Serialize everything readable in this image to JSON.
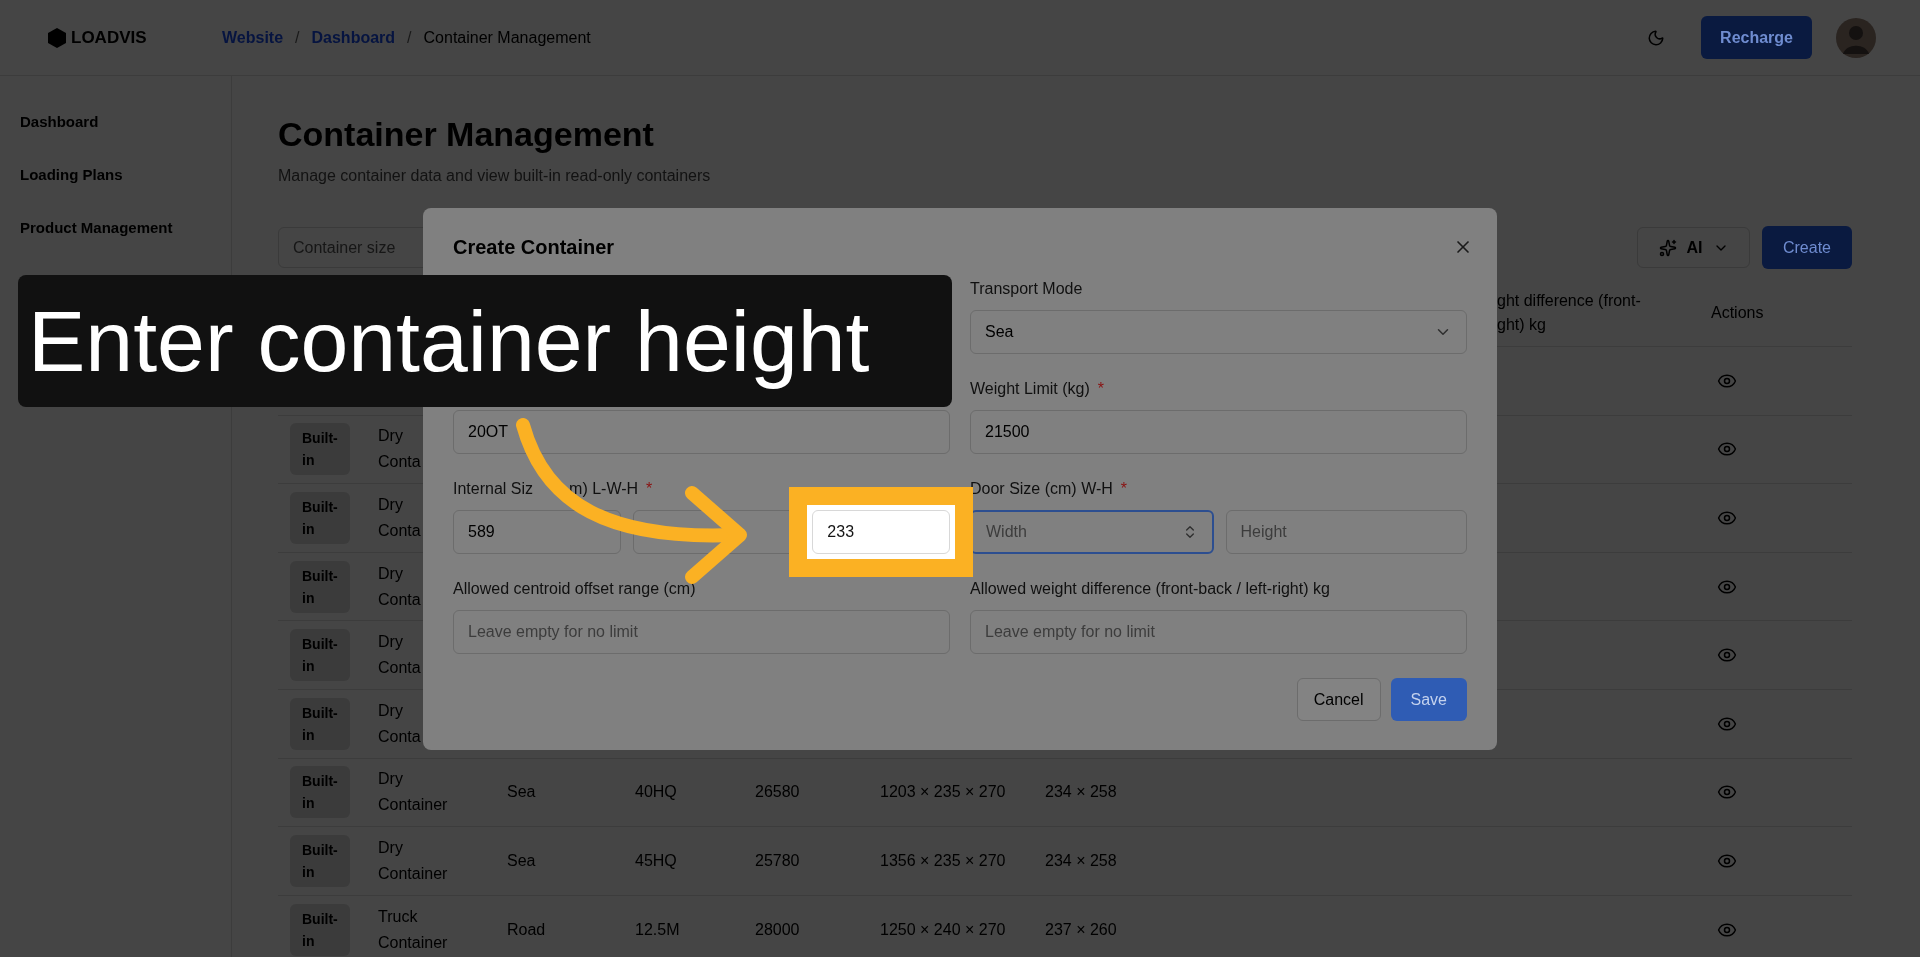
{
  "topbar": {
    "logo": "LOADVIS",
    "breadcrumb": [
      {
        "kind": "link",
        "label": "Website"
      },
      {
        "kind": "separator",
        "label": "/"
      },
      {
        "kind": "link",
        "label": "Dashboard"
      },
      {
        "kind": "separator",
        "label": "/"
      },
      {
        "kind": "current",
        "label": "Container Management"
      }
    ],
    "recharge": "Recharge"
  },
  "sidebar": {
    "items": [
      "Dashboard",
      "Loading Plans",
      "Product Management"
    ]
  },
  "page": {
    "title": "Container Management",
    "subtitle": "Manage container data and view built-in read-only containers",
    "search_placeholder": "Container size",
    "ai_button": "AI",
    "create_button": "Create"
  },
  "table": {
    "header": {
      "weight_diff": [
        "ght difference (front-",
        "ght) kg"
      ],
      "actions": [
        "Actions"
      ]
    },
    "rows": [
      {},
      {
        "source": "Built-in",
        "type": "Dry Conta"
      },
      {
        "source": "Built-in",
        "type": "Dry Conta"
      },
      {
        "source": "Built-in",
        "type": "Dry Conta"
      },
      {
        "source": "Built-in",
        "type": "Dry Conta"
      },
      {
        "source": "Built-in",
        "type": "Dry Conta"
      },
      {
        "source": "Built-in",
        "type": "Dry Container",
        "transport": "Sea",
        "size": "40HQ",
        "weight": "26580",
        "internal": "1203 × 235 × 270",
        "door": "234 × 258"
      },
      {
        "source": "Built-in",
        "type": "Dry Container",
        "transport": "Sea",
        "size": "45HQ",
        "weight": "25780",
        "internal": "1356 × 235 × 270",
        "door": "234 × 258"
      },
      {
        "source": "Built-in",
        "type": "Truck Container",
        "transport": "Road",
        "size": "12.5M",
        "weight": "28000",
        "internal": "1250 × 240 × 270",
        "door": "237 × 260"
      }
    ]
  },
  "modal": {
    "title": "Create Container",
    "rows": [
      {
        "right": {
          "label": [
            "Transport Mode"
          ],
          "inputs": [
            {
              "kind": "select",
              "value": "Sea"
            }
          ]
        }
      },
      {
        "left": {
          "inputs": [
            {
              "kind": "text",
              "value": "20OT"
            }
          ]
        },
        "right": {
          "label": [
            "Weight Limit (kg)"
          ],
          "required_mark": "*",
          "inputs": [
            {
              "kind": "text",
              "value": "21500"
            }
          ]
        }
      },
      {
        "left": {
          "label": [
            "Internal Siz",
            "m) L-W-H"
          ],
          "required_mark": "*",
          "inputs": [
            {
              "kind": "text",
              "value": "589"
            },
            {
              "kind": "text"
            },
            {
              "kind": "text",
              "value": "233",
              "highlighted": true
            }
          ]
        },
        "right": {
          "label": [
            "Door Size (cm) W-H"
          ],
          "required_mark": "*",
          "inputs": [
            {
              "kind": "number",
              "placeholder": "Width",
              "focused": true
            },
            {
              "kind": "text",
              "placeholder": "Height",
              "focused": false
            }
          ]
        }
      },
      {
        "left": {
          "label": [
            "Allowed centroid offset range (cm)"
          ],
          "inputs": [
            {
              "kind": "text",
              "placeholder": "Leave empty for no limit"
            }
          ]
        },
        "right": {
          "label": [
            "Allowed weight difference (front-back / left-right) kg"
          ],
          "inputs": [
            {
              "kind": "text",
              "placeholder": "Leave empty for no limit"
            }
          ]
        }
      }
    ],
    "cancel": "Cancel",
    "save": "Save"
  },
  "caption": "Enter container height"
}
